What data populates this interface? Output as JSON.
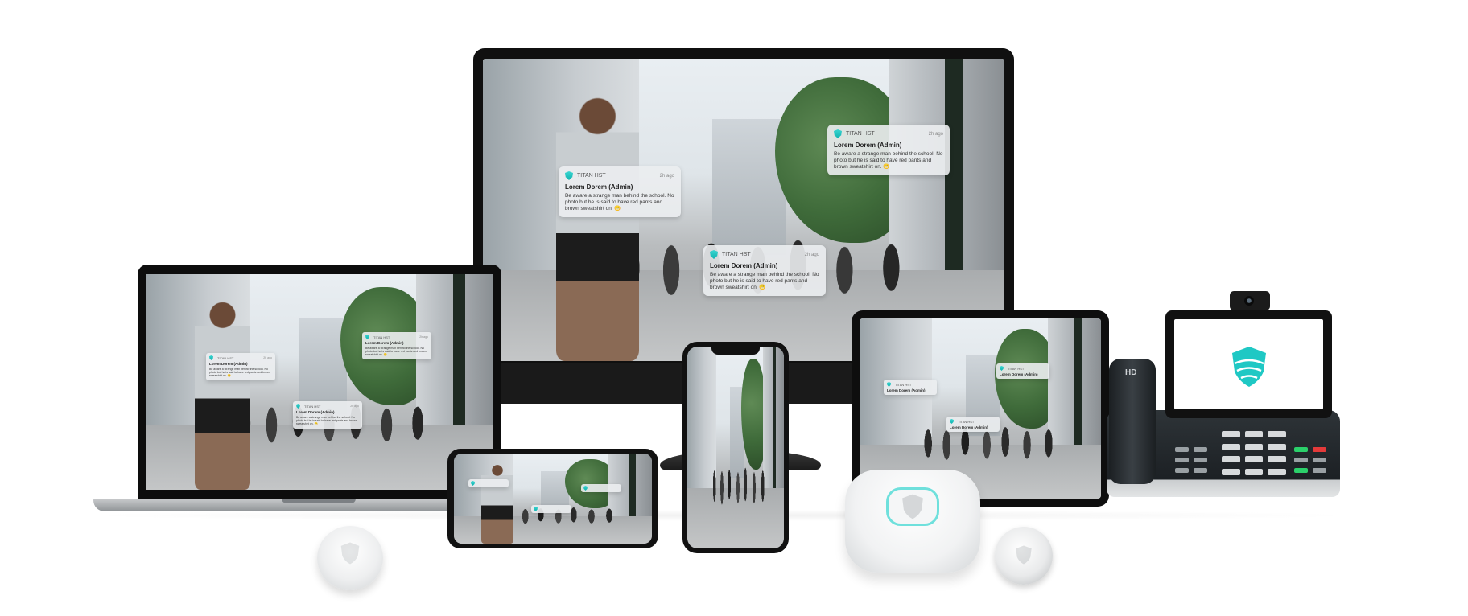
{
  "notification": {
    "app_name": "TITAN HST",
    "time": "2h ago",
    "title": "Lorem Dorem (Admin)",
    "body": "Be aware a strange man behind the school. No photo but he is said to have red pants and brown sweatshirt on. 😬"
  },
  "desk_phone": {
    "badge": "HD"
  },
  "colors": {
    "brand_teal": "#1fc8c4",
    "brand_teal_light": "#6fe0dc"
  },
  "icons": {
    "brand_logo": "shield-logo-icon"
  }
}
